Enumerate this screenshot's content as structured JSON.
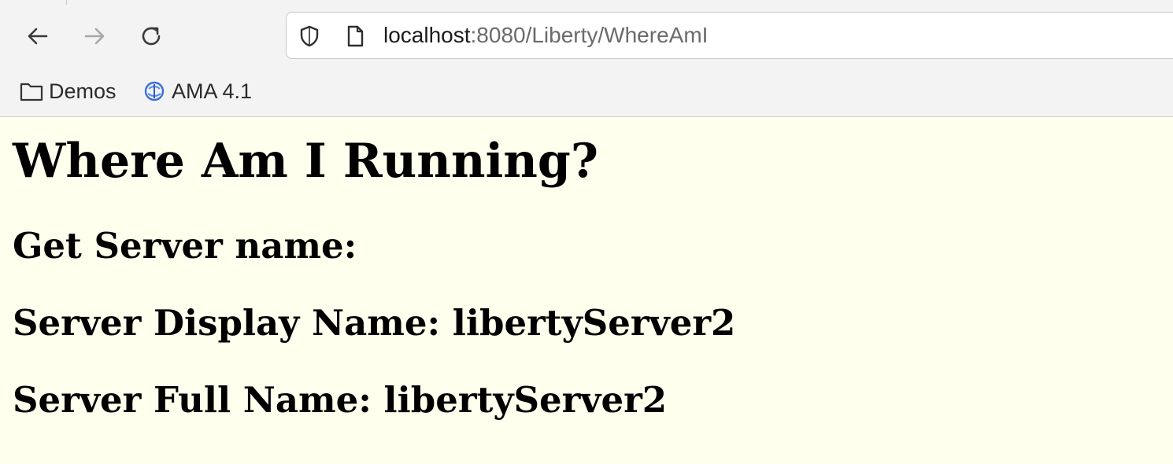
{
  "browser": {
    "url_host": "localhost",
    "url_rest": ":8080/Liberty/WhereAmI",
    "nav_icons": [
      "back-arrow-icon",
      "forward-arrow-icon",
      "reload-icon"
    ],
    "bookmarks": [
      {
        "label": "Demos",
        "icon": "folder-icon"
      },
      {
        "label": "AMA 4.1",
        "icon": "ama-logo-icon"
      }
    ],
    "colors": {
      "chrome_background": "#f3f3f3",
      "page_background": "#ffffee"
    }
  },
  "page": {
    "title": "Where Am I Running?",
    "get_server_name_heading": "Get Server name:",
    "display_name_label": "Server Display Name: ",
    "display_name_value": "libertyServer2",
    "full_name_label": "Server Full Name: ",
    "full_name_value": "libertyServer2"
  }
}
